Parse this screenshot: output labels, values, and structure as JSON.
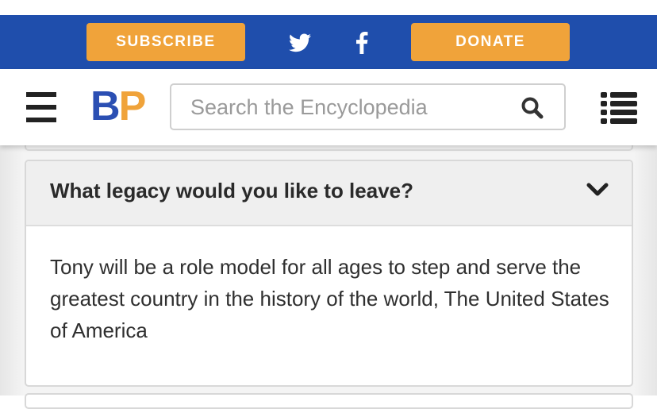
{
  "promo": {
    "subscribe_label": "SUBSCRIBE",
    "donate_label": "DONATE",
    "social_icons": [
      "twitter-icon",
      "facebook-icon"
    ]
  },
  "header": {
    "logo_b": "B",
    "logo_p": "P",
    "search_placeholder": "Search the Encyclopedia"
  },
  "faq": {
    "question": "What legacy would you like to leave?",
    "answer": "Tony will be a role model for all ages to step and serve the greatest country in the history of the world, The United States of America"
  },
  "colors": {
    "promo_bar": "#1f4eac",
    "button_orange": "#f0a33a",
    "logo_blue": "#2b4fb3",
    "logo_orange": "#f0a33a"
  }
}
